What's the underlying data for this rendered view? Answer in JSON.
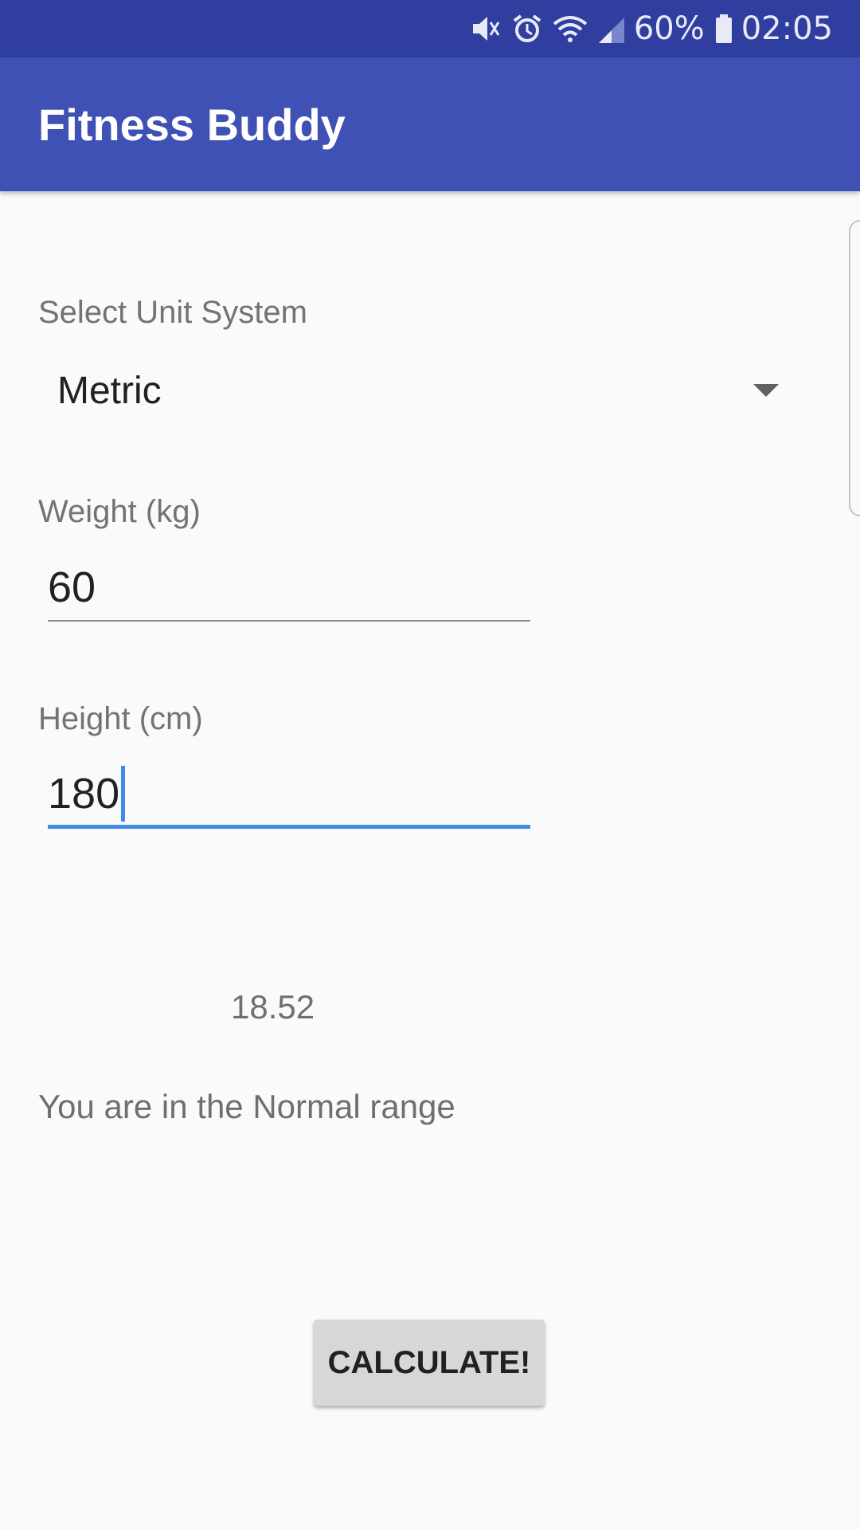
{
  "status_bar": {
    "battery": "60%",
    "time": "02:05",
    "icons": [
      "mute-icon",
      "alarm-icon",
      "wifi-icon",
      "signal-icon",
      "battery-icon"
    ]
  },
  "app_bar": {
    "title": "Fitness Buddy"
  },
  "form": {
    "unit_label": "Select Unit System",
    "unit_selected": "Metric",
    "weight_label": "Weight (kg)",
    "weight_value": "60",
    "height_label": "Height (cm)",
    "height_value": "180"
  },
  "result": {
    "bmi": "18.52",
    "message": "You are in the Normal range"
  },
  "actions": {
    "calculate_label": "CALCULATE!"
  },
  "colors": {
    "status_bar": "#303f9f",
    "app_bar": "#3f51b5",
    "focus_accent": "#3f8be6",
    "background": "#fafafa"
  }
}
